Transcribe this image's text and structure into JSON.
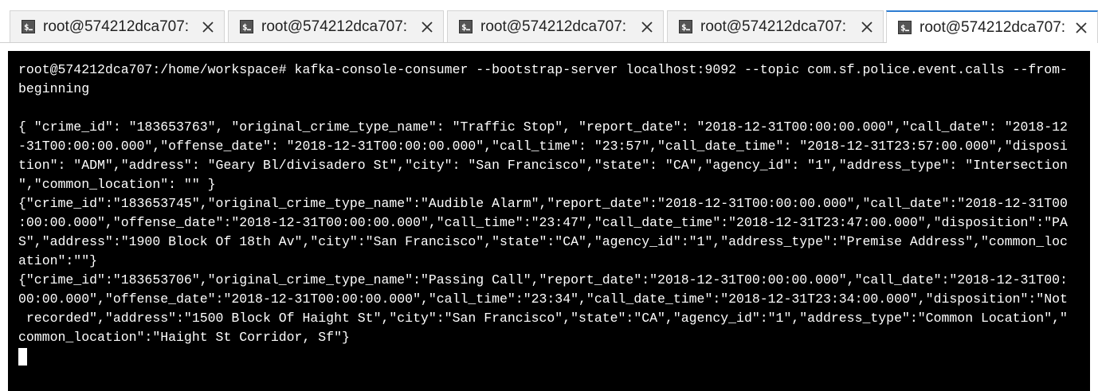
{
  "tabs": [
    {
      "title": "root@574212dca707:",
      "active": false
    },
    {
      "title": "root@574212dca707:",
      "active": false
    },
    {
      "title": "root@574212dca707:",
      "active": false
    },
    {
      "title": "root@574212dca707:",
      "active": false
    },
    {
      "title": "root@574212dca707:",
      "active": true
    }
  ],
  "icons": {
    "tab_icon": "terminal-icon",
    "close_icon": "close-icon"
  },
  "colors": {
    "terminal_background": "#000000",
    "terminal_text": "#ffffff",
    "active_tab_accent": "#2d7dd2"
  },
  "terminal": {
    "lines": [
      "root@574212dca707:/home/workspace# kafka-console-consumer --bootstrap-server localhost:9092 --topic com.sf.police.event.calls --from-",
      "beginning",
      "",
      "{ \"crime_id\": \"183653763\", \"original_crime_type_name\": \"Traffic Stop\", \"report_date\": \"2018-12-31T00:00:00.000\",\"call_date\": \"2018-12",
      "-31T00:00:00.000\",\"offense_date\": \"2018-12-31T00:00:00.000\",\"call_time\": \"23:57\",\"call_date_time\": \"2018-12-31T23:57:00.000\",\"disposi",
      "tion\": \"ADM\",\"address\": \"Geary Bl/divisadero St\",\"city\": \"San Francisco\",\"state\": \"CA\",\"agency_id\": \"1\",\"address_type\": \"Intersection",
      "\",\"common_location\": \"\" }",
      "{\"crime_id\":\"183653745\",\"original_crime_type_name\":\"Audible Alarm\",\"report_date\":\"2018-12-31T00:00:00.000\",\"call_date\":\"2018-12-31T00",
      ":00:00.000\",\"offense_date\":\"2018-12-31T00:00:00.000\",\"call_time\":\"23:47\",\"call_date_time\":\"2018-12-31T23:47:00.000\",\"disposition\":\"PA",
      "S\",\"address\":\"1900 Block Of 18th Av\",\"city\":\"San Francisco\",\"state\":\"CA\",\"agency_id\":\"1\",\"address_type\":\"Premise Address\",\"common_loc",
      "ation\":\"\"}",
      "{\"crime_id\":\"183653706\",\"original_crime_type_name\":\"Passing Call\",\"report_date\":\"2018-12-31T00:00:00.000\",\"call_date\":\"2018-12-31T00:",
      "00:00.000\",\"offense_date\":\"2018-12-31T00:00:00.000\",\"call_time\":\"23:34\",\"call_date_time\":\"2018-12-31T23:34:00.000\",\"disposition\":\"Not",
      " recorded\",\"address\":\"1500 Block Of Haight St\",\"city\":\"San Francisco\",\"state\":\"CA\",\"agency_id\":\"1\",\"address_type\":\"Common Location\",\"",
      "common_location\":\"Haight St Corridor, Sf\"}"
    ]
  }
}
